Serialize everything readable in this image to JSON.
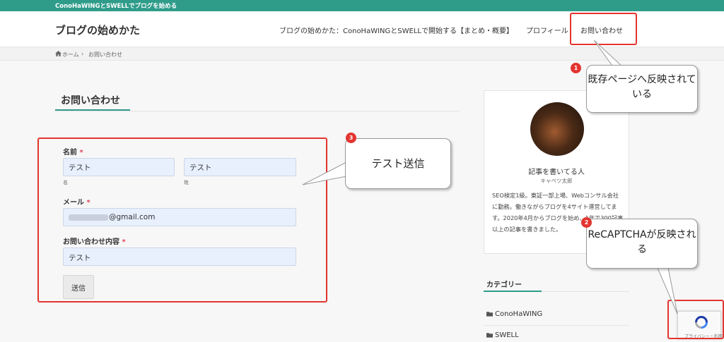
{
  "topbar": {
    "text": "ConoHaWINGとSWELLでブログを始める"
  },
  "header": {
    "site_title": "ブログの始めかた",
    "nav": [
      {
        "label": "ブログの始めかた：ConoHaWINGとSWELLで開始する【まとめ・概要】"
      },
      {
        "label": "プロフィール"
      },
      {
        "label": "お問い合わせ"
      }
    ]
  },
  "breadcrumb": {
    "home": "ホーム",
    "separator": "›",
    "current": "お問い合わせ"
  },
  "main": {
    "page_title": "お問い合わせ",
    "form": {
      "name_label": "名前",
      "required_mark": "*",
      "first_name_value": "テスト",
      "first_name_sublabel": "名",
      "last_name_value": "テスト",
      "last_name_sublabel": "姓",
      "email_label": "メール",
      "email_value": "@gmail.com",
      "message_label": "お問い合わせ内容",
      "message_value": "テスト",
      "submit_label": "送信"
    }
  },
  "sidebar": {
    "profile": {
      "name": "記事を書いてる人",
      "subtitle": "キャベツ太郎",
      "bio": "SEO検定1級。東証一部上場、Webコンサル会社に勤務。働きながらブログを4サイト運営してます。2020年4月からブログを始め、1年で300記事以上の記事を書きました。"
    },
    "categories": {
      "heading": "カテゴリー",
      "items": [
        {
          "label": "ConoHaWING"
        },
        {
          "label": "SWELL"
        }
      ]
    }
  },
  "annotations": {
    "badge1": "1",
    "bubble1": "既存ページへ反映されている",
    "badge2": "2",
    "bubble2": "ReCAPTCHAが反映される",
    "badge3": "3",
    "bubble3": "テスト送信"
  },
  "recaptcha": {
    "label": "プライバシー・利用規約"
  },
  "colors": {
    "accent": "#2f9c8a",
    "annotation_red": "#e3342f",
    "required": "#e0445a",
    "input_bg": "#e8f0fe"
  }
}
